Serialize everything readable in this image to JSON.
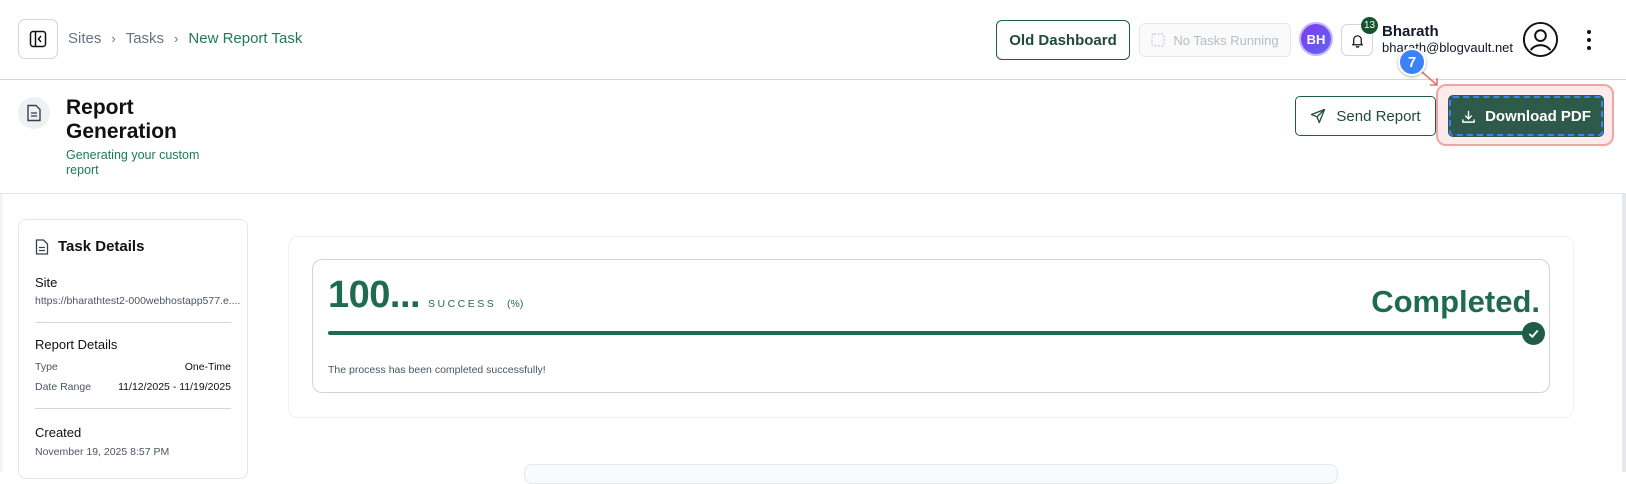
{
  "breadcrumb": {
    "items": [
      "Sites",
      "Tasks"
    ],
    "current": "New Report Task"
  },
  "topbar": {
    "old_dashboard_label": "Old Dashboard",
    "tasks_status": "No Tasks Running",
    "avatar_initials": "BH",
    "notification_count": "13",
    "user_name": "Bharath",
    "user_email": "bharath@blogvault.net"
  },
  "annotation": {
    "step_number": "7"
  },
  "header": {
    "title": "Report Generation",
    "subtitle": "Generating your custom report",
    "send_report_label": "Send Report",
    "download_pdf_label": "Download PDF"
  },
  "task_details": {
    "title": "Task Details",
    "site_label": "Site",
    "site_url": "https://bharathtest2-000webhostapp577.e....",
    "report_details_label": "Report Details",
    "type_label": "Type",
    "type_value": "One-Time",
    "date_range_label": "Date Range",
    "date_range_value": "11/12/2025 - 11/19/2025",
    "created_label": "Created",
    "created_value": "November 19, 2025 8:57 PM"
  },
  "progress": {
    "value_display": "100...",
    "success_label": "SUCCESS",
    "unit_label": "(%)",
    "status_text": "Completed.",
    "message": "The process has been completed successfully!",
    "progress_fraction": 1.0
  },
  "colors": {
    "accent": "#1f6b4f",
    "primary_button": "#2d5a4a",
    "annotation_blue": "#3b82f6"
  },
  "icons": [
    "sidebar-toggle-icon",
    "bell-icon",
    "user-circle-icon",
    "more-vertical-icon",
    "document-icon",
    "send-icon",
    "download-icon",
    "check-icon",
    "file-text-icon"
  ]
}
